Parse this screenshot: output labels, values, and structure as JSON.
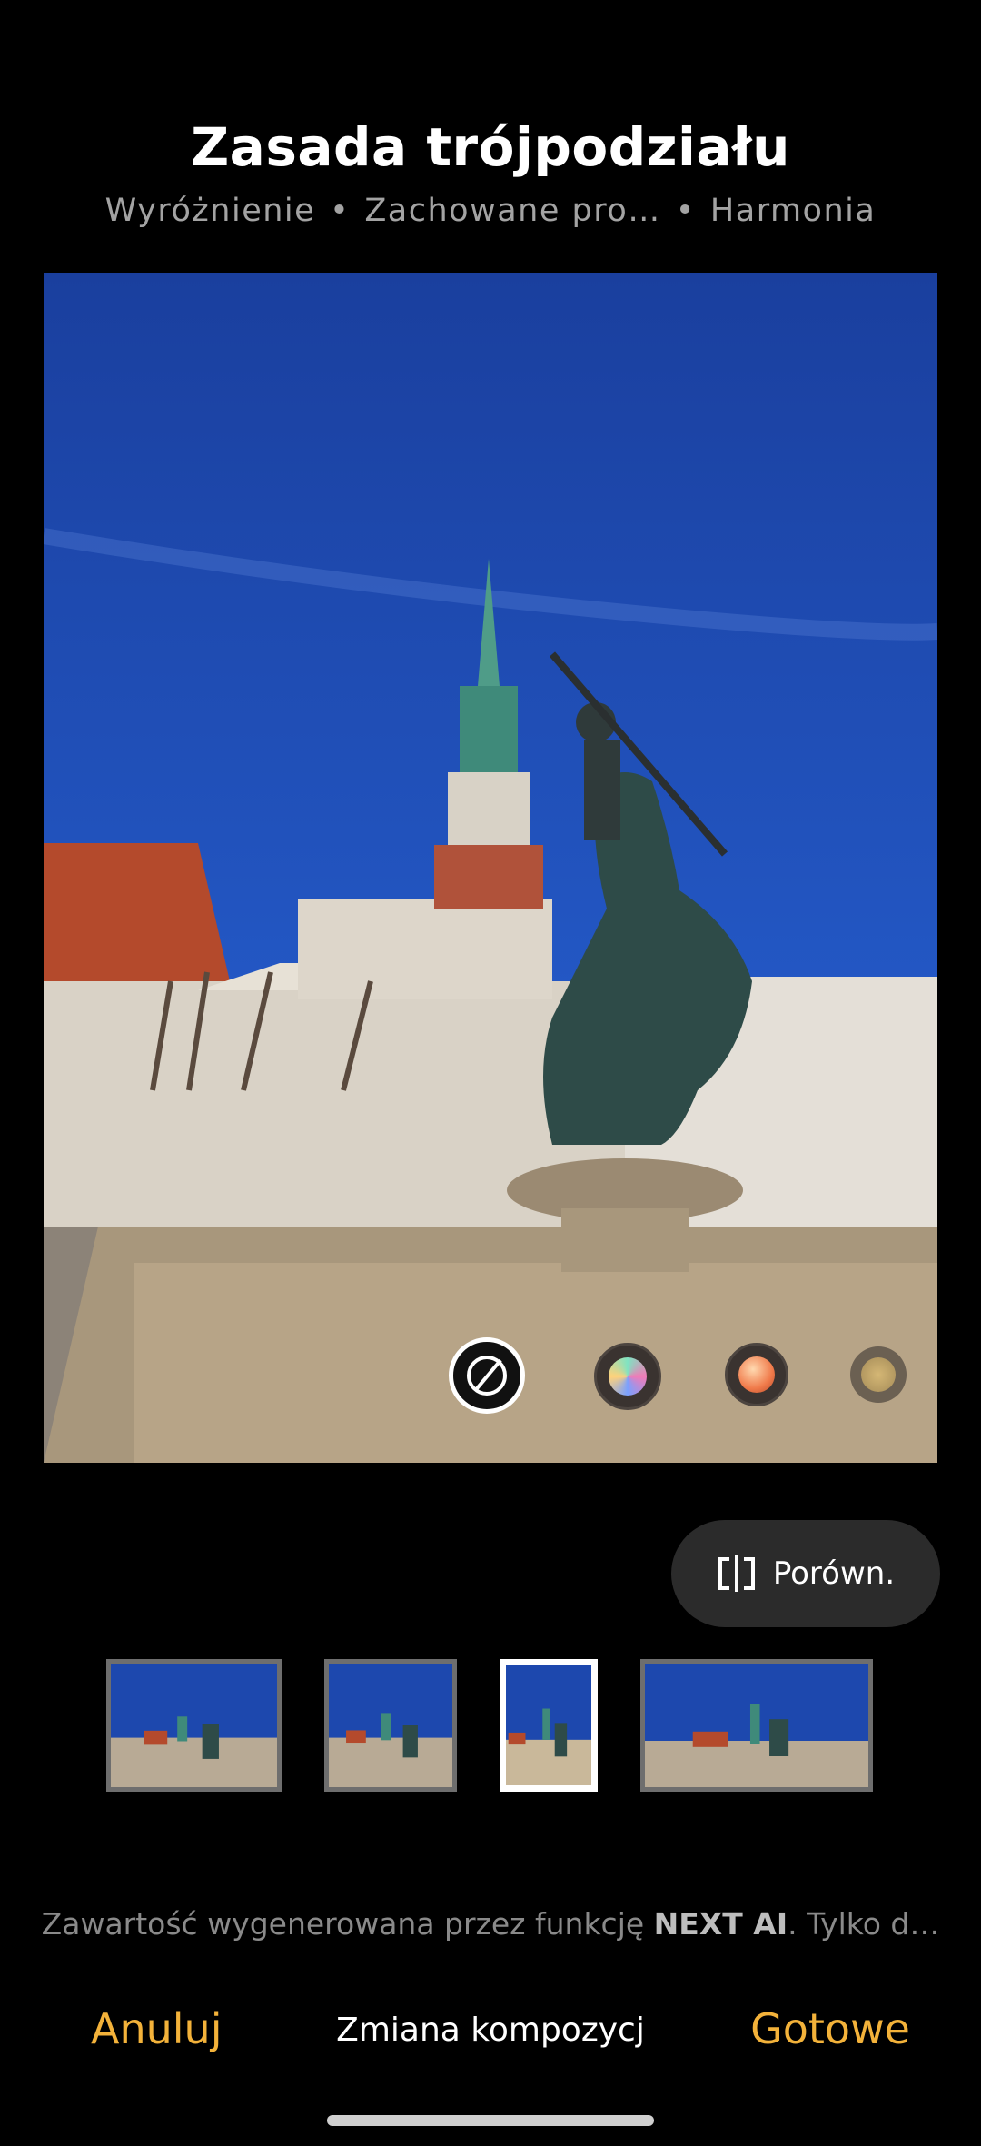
{
  "header": {
    "title": "Zasada trójpodziału",
    "tags": [
      "Wyróżnienie",
      "Zachowane pro…",
      "Harmonia"
    ],
    "separator": "•"
  },
  "effects": {
    "items": [
      "none-icon",
      "gradient-effect-icon",
      "warm-effect-icon",
      "gold-effect-icon"
    ],
    "selected": "none-icon"
  },
  "compare": {
    "label": "Porówn.",
    "icon": "compare-icon"
  },
  "thumbnails": {
    "count": 4,
    "selected_index": 2
  },
  "disclaimer": {
    "prefix": "Zawartość wygenerowana przez funkcję ",
    "brand": "NEXT AI",
    "suffix": ". Tylko d…"
  },
  "bottom_bar": {
    "cancel_label": "Anuluj",
    "mode_label": "Zmiana kompozycj",
    "done_label": "Gotowe"
  },
  "colors": {
    "accent": "#f3b23a",
    "background": "#000000",
    "sky": "#1d48ae"
  }
}
